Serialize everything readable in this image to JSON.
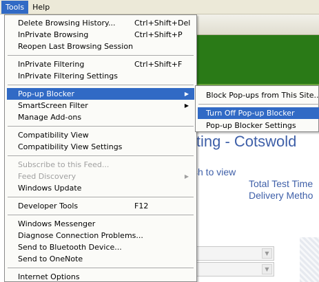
{
  "menubar": {
    "items": [
      "Tools",
      "Help"
    ]
  },
  "tools_menu": {
    "groups": [
      [
        {
          "label": "Delete Browsing History...",
          "shortcut": "Ctrl+Shift+Del"
        },
        {
          "label": "InPrivate Browsing",
          "shortcut": "Ctrl+Shift+P"
        },
        {
          "label": "Reopen Last Browsing Session",
          "shortcut": ""
        }
      ],
      [
        {
          "label": "InPrivate Filtering",
          "shortcut": "Ctrl+Shift+F"
        },
        {
          "label": "InPrivate Filtering Settings",
          "shortcut": ""
        }
      ],
      [
        {
          "label": "Pop-up Blocker",
          "shortcut": "",
          "submenu": true,
          "selected": true
        },
        {
          "label": "SmartScreen Filter",
          "shortcut": "",
          "submenu": true
        },
        {
          "label": "Manage Add-ons",
          "shortcut": ""
        }
      ],
      [
        {
          "label": "Compatibility View",
          "shortcut": ""
        },
        {
          "label": "Compatibility View Settings",
          "shortcut": ""
        }
      ],
      [
        {
          "label": "Subscribe to this Feed...",
          "shortcut": "",
          "disabled": true
        },
        {
          "label": "Feed Discovery",
          "shortcut": "",
          "submenu": true,
          "disabled": true
        },
        {
          "label": "Windows Update",
          "shortcut": ""
        }
      ],
      [
        {
          "label": "Developer Tools",
          "shortcut": "F12"
        }
      ],
      [
        {
          "label": "Windows Messenger",
          "shortcut": ""
        },
        {
          "label": "Diagnose Connection Problems...",
          "shortcut": ""
        },
        {
          "label": "Send to Bluetooth Device...",
          "shortcut": ""
        },
        {
          "label": "Send to OneNote",
          "shortcut": ""
        }
      ],
      [
        {
          "label": "Internet Options",
          "shortcut": ""
        }
      ]
    ]
  },
  "popup_submenu": {
    "items": [
      {
        "label": "Block Pop-ups from This Site...",
        "selected": false
      },
      {
        "label": "Turn Off Pop-up Blocker",
        "selected": true
      },
      {
        "label": "Pop-up Blocker Settings",
        "selected": false
      }
    ]
  },
  "background_page": {
    "title": "iting - Cotswold",
    "link": "sh to view",
    "labels": [
      "Total Test Time",
      "Delivery Metho"
    ]
  },
  "colors": {
    "highlight": "#316ac5",
    "menubar": "#ece9d8",
    "banner": "#2a7a17",
    "page_text": "#3e5fa8"
  }
}
